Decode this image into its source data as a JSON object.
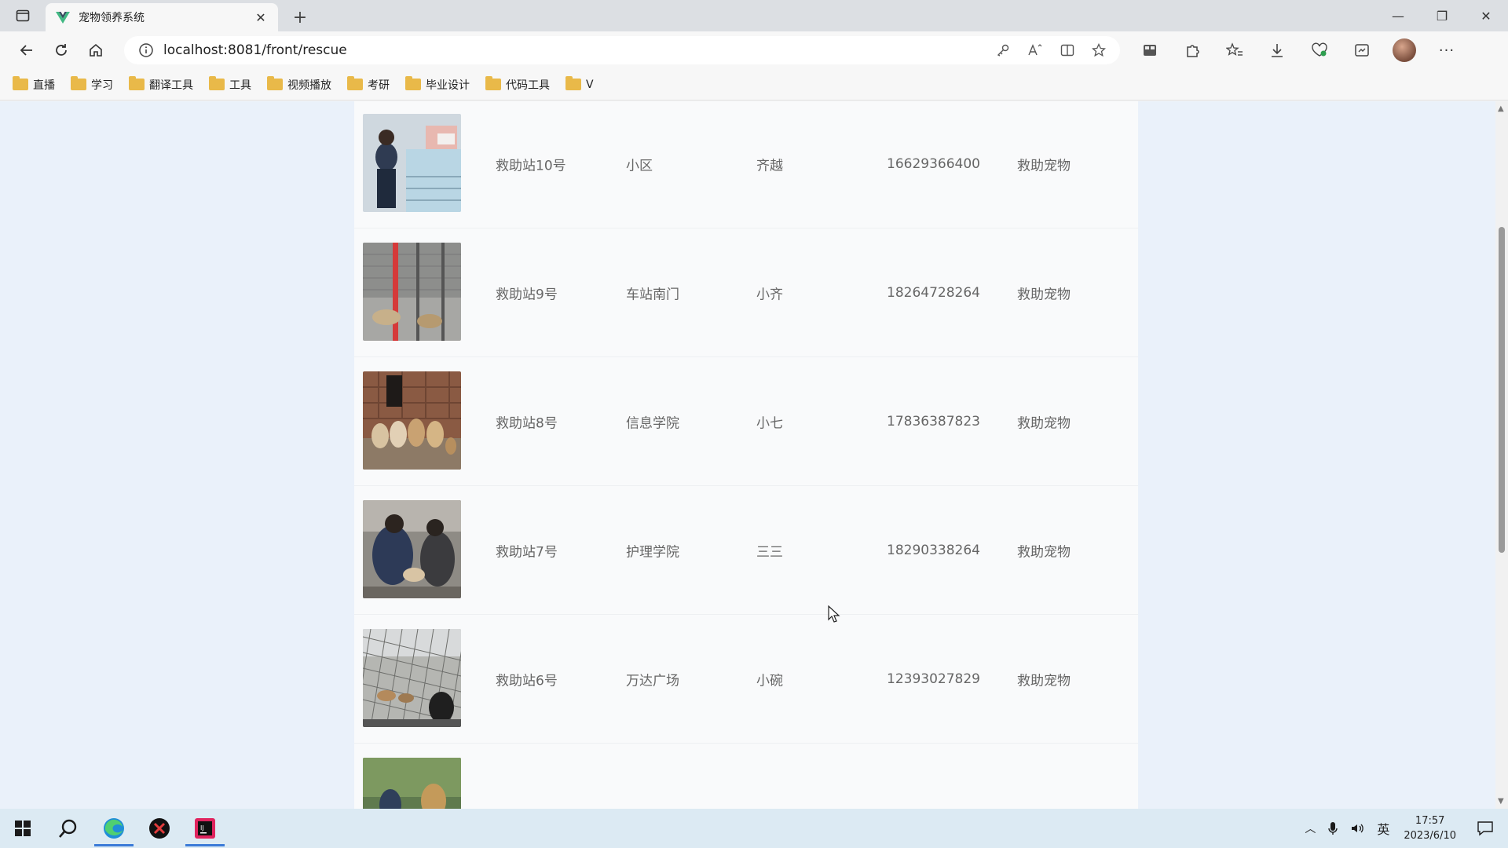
{
  "browser": {
    "tab_title": "宠物领养系统",
    "url": "localhost:8081/front/rescue",
    "bookmarks": [
      "直播",
      "学习",
      "翻译工具",
      "工具",
      "视频播放",
      "考研",
      "毕业设计",
      "代码工具",
      "V"
    ]
  },
  "rescue_list": [
    {
      "name": "救助站10号",
      "address": "小区",
      "person": "齐越",
      "phone": "16629366400",
      "type": "救助宠物"
    },
    {
      "name": "救助站9号",
      "address": "车站南门",
      "person": "小齐",
      "phone": "18264728264",
      "type": "救助宠物"
    },
    {
      "name": "救助站8号",
      "address": "信息学院",
      "person": "小七",
      "phone": "17836387823",
      "type": "救助宠物"
    },
    {
      "name": "救助站7号",
      "address": "护理学院",
      "person": "三三",
      "phone": "18290338264",
      "type": "救助宠物"
    },
    {
      "name": "救助站6号",
      "address": "万达广场",
      "person": "小碗",
      "phone": "12393027829",
      "type": "救助宠物"
    }
  ],
  "taskbar": {
    "ime": "英",
    "time": "17:57",
    "date": "2023/6/10"
  }
}
